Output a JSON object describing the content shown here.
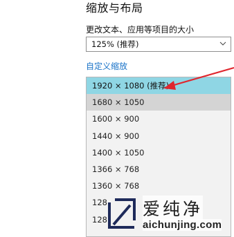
{
  "section": {
    "title": "缩放与布局",
    "scale_label": "更改文本、应用等项目的大小",
    "scale_selected": "125% (推荐)",
    "custom_link": "自定义缩放"
  },
  "resolution_list": {
    "items": [
      "1920 × 1080 (推荐)",
      "1680 × 1050",
      "1600 × 900",
      "1440 × 900",
      "1400 × 1050",
      "1366 × 768",
      "1360 × 768",
      "128",
      "128"
    ],
    "selected_index": 0,
    "hover_index": 1
  },
  "annotation": {
    "arrow_color": "#e0262e"
  },
  "watermark": {
    "brand": "爱纯净",
    "url": "aichunjing.com"
  },
  "colors": {
    "selected_bg": "#8fd6e4",
    "link": "#1a73c8"
  }
}
